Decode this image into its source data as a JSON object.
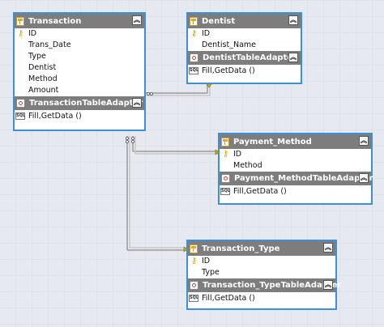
{
  "tables": {
    "transaction": {
      "name": "Transaction",
      "fields": [
        {
          "name": "ID",
          "key": true
        },
        {
          "name": "Trans_Date",
          "key": false
        },
        {
          "name": "Type",
          "key": false
        },
        {
          "name": "Dentist",
          "key": false
        },
        {
          "name": "Method",
          "key": false
        },
        {
          "name": "Amount",
          "key": false
        }
      ],
      "adapter": "TransactionTableAdapter",
      "method": "Fill,GetData ()"
    },
    "dentist": {
      "name": "Dentist",
      "fields": [
        {
          "name": "ID",
          "key": true
        },
        {
          "name": "Dentist_Name",
          "key": false
        }
      ],
      "adapter": "DentistTableAdapter",
      "method": "Fill,GetData ()"
    },
    "payment_method": {
      "name": "Payment_Method",
      "fields": [
        {
          "name": "ID",
          "key": true
        },
        {
          "name": "Method",
          "key": false
        }
      ],
      "adapter": "Payment_MethodTableAdapter",
      "method": "Fill,GetData ()"
    },
    "transaction_type": {
      "name": "Transaction_Type",
      "fields": [
        {
          "name": "ID",
          "key": true
        },
        {
          "name": "Type",
          "key": false
        }
      ],
      "adapter": "Transaction_TypeTableAdapter",
      "method": "Fill,GetData ()"
    }
  },
  "icons": {
    "collapse": "double-chevron-up-icon",
    "key": "primary-key-icon",
    "table": "table-icon",
    "adapter": "table-adapter-icon",
    "method": "sql-method-icon"
  },
  "colors": {
    "selection_border": "#3d8fd8",
    "header_bg": "#7d7d7d",
    "relation_line": "#9a9a9a",
    "key_icon": "#d8a800"
  }
}
